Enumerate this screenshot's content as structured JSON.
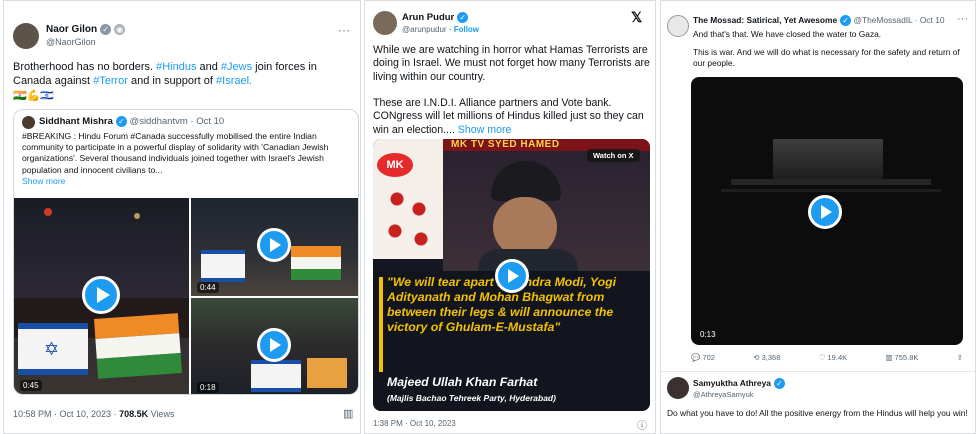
{
  "tweet1": {
    "author_name": "Naor Gilon",
    "author_handle": "@NaorGilon",
    "text_a": "Brotherhood has no borders. ",
    "tag_hindus": "#Hindus",
    "text_b": " and ",
    "tag_jews": "#Jews",
    "text_c": " join forces in Canada against ",
    "tag_terror": "#Terror",
    "text_d": " and in support of ",
    "tag_israel": "#Israel.",
    "emojis": "🇮🇳💪🇮🇱",
    "quoted": {
      "author_name": "Siddhant Mishra",
      "author_handle": "@siddhantvm",
      "date": "· Oct 10",
      "text": "#BREAKING : Hindu Forum #Canada successfully mobilised the entire Indian community to participate in a powerful display of solidarity with 'Canadian Jewish organizations'. Several thousand individuals joined together with Israel's Jewish population and innocent civilians to...",
      "show_more": "Show more",
      "durations": [
        "0:45",
        "0:44",
        "0:18"
      ]
    },
    "timestamp": "10:58 PM · Oct 10, 2023 · ",
    "views_count": "708.5K",
    "views_label": " Views"
  },
  "tweet2": {
    "author_name": "Arun Pudur",
    "author_handle": "@arunpudur",
    "follow": "Follow",
    "x_logo": "𝕏",
    "para1": "While we are watching in horror what Hamas Terrorists are doing in Israel. We must not forget how many Terrorists are living within our country.",
    "para2": "These are I.N.D.I. Alliance partners and Vote bank. CONgress will let millions of Hindus killed just so they can win an election.... ",
    "show_more": "Show more",
    "video": {
      "channel_label": "MK TV SYED HAMED",
      "badge": "MK",
      "watch_label": "Watch on X",
      "quote": "\"We will tear apart Narendra Modi, Yogi Adityanath and Mohan Bhagwat from between their legs & will announce the victory of Ghulam-E-Mustafa\"",
      "speaker": "Majeed Ullah Khan Farhat",
      "party": "(Majlis Bachao Tehreek Party, Hyderabad)"
    },
    "timestamp": "1:38 PM · Oct 10, 2023"
  },
  "tweet3": {
    "author_name": "The Mossad: Satirical, Yet Awesome",
    "author_handle": "@TheMossadIL",
    "date": "· Oct 10",
    "line1": "And that's that. We have closed the water to Gaza.",
    "line2": "This is war. And we will do what is necessary for the safety and return of our people.",
    "duration": "0:13",
    "actions": {
      "replies": "702",
      "reposts": "3,368",
      "likes": "19.4K",
      "views": "755.8K"
    },
    "reply": {
      "author_name": "Samyuktha Athreya",
      "author_handle": "@AthreyaSamyuk",
      "text": "Do what you have to do! All the positive energy from the Hindus  will help you win!"
    }
  },
  "colors": {
    "accent": "#1d9bf0",
    "text": "#0f1419",
    "muted": "#536471",
    "caption_yellow": "#f2c200"
  }
}
